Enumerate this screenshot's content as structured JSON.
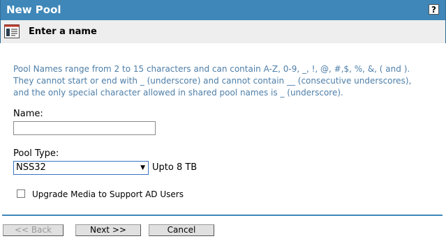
{
  "window": {
    "title": "New Pool",
    "help_label": "?"
  },
  "step": {
    "title": "Enter a name",
    "icon": "wizard-form-icon"
  },
  "description": {
    "lines": [
      "Pool Names range from 2 to 15 characters and can contain A-Z, 0-9, _, !, @, #,$, %, &, ( and ).",
      "They cannot start or end with _ (underscore) and cannot contain __ (consecutive underscores),",
      "and the only special character allowed in shared pool names is _ (underscore)."
    ]
  },
  "name_field": {
    "label": "Name:",
    "value": ""
  },
  "pool_type": {
    "label": "Pool Type:",
    "selected": "NSS32",
    "note": "Upto 8 TB"
  },
  "ad_option": {
    "label": "Upgrade Media to Support AD Users",
    "checked": false
  },
  "buttons": {
    "back": "<< Back",
    "next": "Next >>",
    "cancel": "Cancel"
  },
  "colors": {
    "titlebar": "#3e87b8",
    "description_text": "#4d7ea8",
    "divider": "#3e87b8"
  }
}
